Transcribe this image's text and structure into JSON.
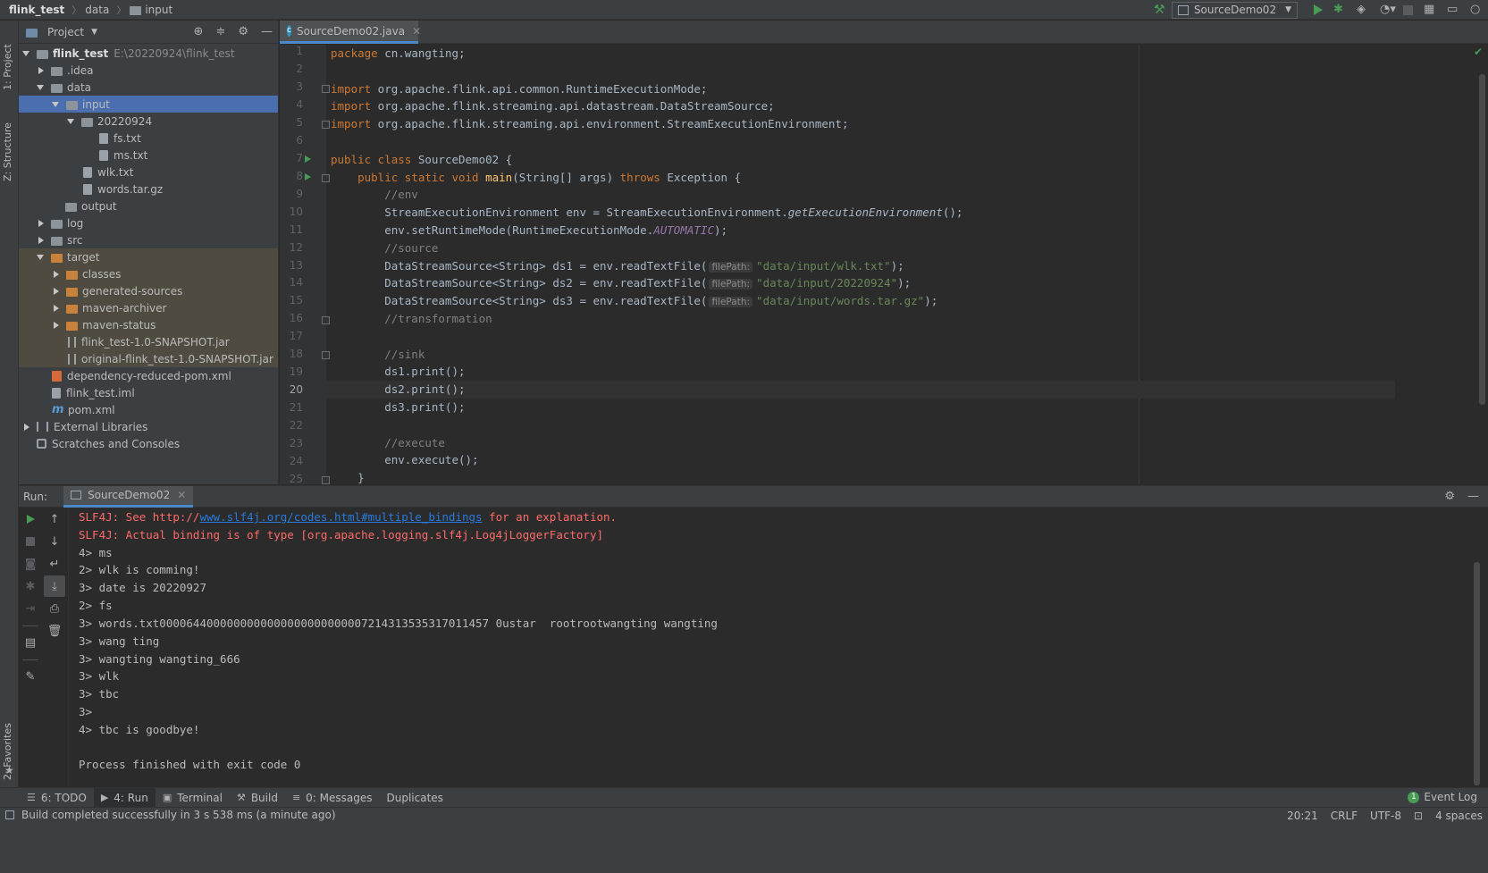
{
  "breadcrumb": {
    "project": "flink_test",
    "folder1": "data",
    "folder2": "input"
  },
  "toolbar": {
    "run_config": "SourceDemo02"
  },
  "left_strip": {
    "project_tab": "1: Project",
    "structure_tab": "Z: Structure",
    "favorites_tab": "2: Favorites"
  },
  "project_panel": {
    "title": "Project",
    "tree": [
      {
        "label": "flink_test",
        "extra": "E:\\20220924\\flink_test"
      },
      {
        "label": ".idea"
      },
      {
        "label": "data"
      },
      {
        "label": "input"
      },
      {
        "label": "20220924"
      },
      {
        "label": "fs.txt"
      },
      {
        "label": "ms.txt"
      },
      {
        "label": "wlk.txt"
      },
      {
        "label": "words.tar.gz"
      },
      {
        "label": "output"
      },
      {
        "label": "log"
      },
      {
        "label": "src"
      },
      {
        "label": "target"
      },
      {
        "label": "classes"
      },
      {
        "label": "generated-sources"
      },
      {
        "label": "maven-archiver"
      },
      {
        "label": "maven-status"
      },
      {
        "label": "flink_test-1.0-SNAPSHOT.jar"
      },
      {
        "label": "original-flink_test-1.0-SNAPSHOT.jar"
      },
      {
        "label": "dependency-reduced-pom.xml"
      },
      {
        "label": "flink_test.iml"
      },
      {
        "label": "pom.xml"
      },
      {
        "label": "External Libraries"
      },
      {
        "label": "Scratches and Consoles"
      }
    ]
  },
  "editor": {
    "tab": "SourceDemo02.java",
    "line_numbers": [
      "1",
      "2",
      "3",
      "4",
      "5",
      "6",
      "7",
      "8",
      "9",
      "10",
      "11",
      "12",
      "13",
      "14",
      "15",
      "16",
      "17",
      "18",
      "19",
      "20",
      "21",
      "22",
      "23",
      "24",
      "25"
    ],
    "current_line": "20",
    "code": {
      "l1_kw": "package",
      "l1_rest": " cn.wangting;",
      "l3_kw": "import",
      "l3_rest": " org.apache.flink.api.common.RuntimeExecutionMode;",
      "l4_kw": "import",
      "l4_rest": " org.apache.flink.streaming.api.datastream.DataStreamSource;",
      "l5_kw": "import",
      "l5_rest": " org.apache.flink.streaming.api.environment.StreamExecutionEnvironment;",
      "l7_kw": "public class",
      "l7_rest": " SourceDemo02 {",
      "l8_indent": "    ",
      "l8_kw1": "public static void",
      "l8_fn": "main",
      "l8_mid": "(String[] args) ",
      "l8_kw2": "throws",
      "l8_rest": " Exception {",
      "l9": "        //env",
      "l10_a": "        StreamExecutionEnvironment env = StreamExecutionEnvironment.",
      "l10_it": "getExecutionEnvironment",
      "l10_b": "();",
      "l11_a": "        env.setRuntimeMode(RuntimeExecutionMode.",
      "l11_it": "AUTOMATIC",
      "l11_b": ");",
      "l12": "        //source",
      "l13_a": "        DataStreamSource<String> ds1 = env.readTextFile(",
      "l13_str": "\"data/input/wlk.txt\"",
      "l13_b": ");",
      "l14_a": "        DataStreamSource<String> ds2 = env.readTextFile(",
      "l14_str": "\"data/input/20220924\"",
      "l14_b": ");",
      "l15_a": "        DataStreamSource<String> ds3 = env.readTextFile(",
      "l15_str": "\"data/input/words.tar.gz\"",
      "l15_b": ");",
      "hint": "filePath:",
      "l16": "        //transformation",
      "l18": "        //sink",
      "l19": "        ds1.print();",
      "l20": "        ds2.print();",
      "l21": "        ds3.print();",
      "l23": "        //execute",
      "l24": "        env.execute();",
      "l25": "    }"
    }
  },
  "run_panel": {
    "label": "Run:",
    "tab": "SourceDemo02",
    "console": {
      "l1_a": "SLF4J: See http://",
      "l1_link": "www.slf4j.org/codes.html#multiple_bindings",
      "l1_b": " for an explanation.",
      "l2": "SLF4J: Actual binding is of type [org.apache.logging.slf4j.Log4jLoggerFactory]",
      "l3": "4> ms",
      "l4": "2> wlk is comming!",
      "l5": "3> date is 20220927",
      "l6": "2> fs",
      "l7": "3> words.txt0000644000000000000000000000007214313535317011457 0ustar  rootrootwangting wangting",
      "l8": "3> wang ting",
      "l9": "3> wangting wangting_666",
      "l10": "3> wlk",
      "l11": "3> tbc",
      "l12": "3>",
      "l13": "4> tbc is goodbye!",
      "l15": "Process finished with exit code 0"
    }
  },
  "bottom_tabs": {
    "todo": "6: TODO",
    "run": "4: Run",
    "terminal": "Terminal",
    "build": "Build",
    "messages": "0: Messages",
    "duplicates": "Duplicates",
    "event_log": "Event Log"
  },
  "status_bar": {
    "message": "Build completed successfully in 3 s 538 ms (a minute ago)",
    "position": "20:21",
    "line_sep": "CRLF",
    "encoding": "UTF-8",
    "indent": "4 spaces"
  },
  "colors": {
    "accent": "#4a88c7",
    "selection": "#4b6eaf",
    "keyword": "#cc7832",
    "string": "#6a8759",
    "error": "#ff6b68",
    "run_green": "#499c54"
  }
}
